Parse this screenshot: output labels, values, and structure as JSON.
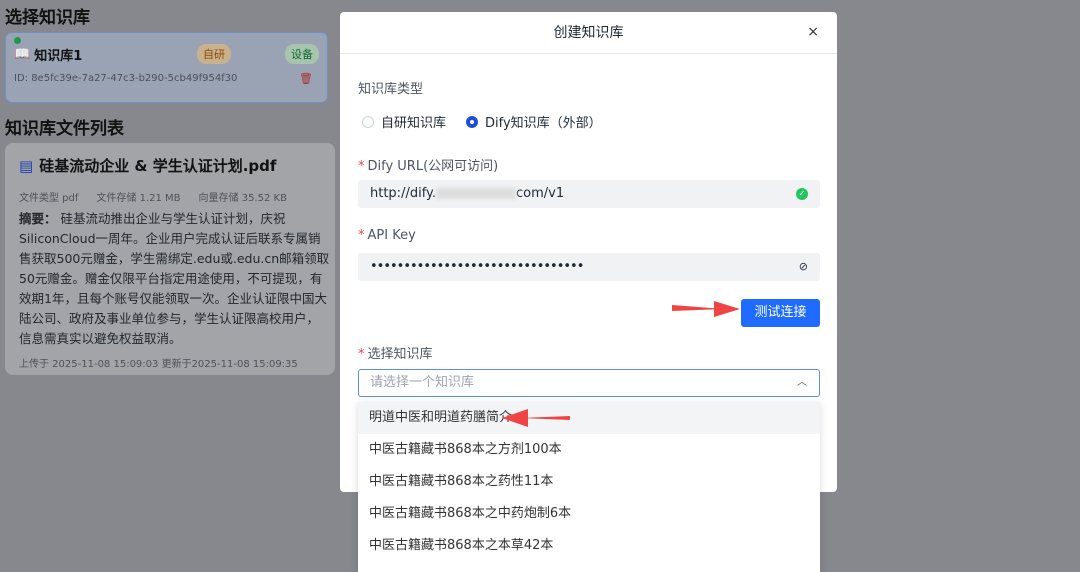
{
  "background": {
    "select_heading": "选择知识库",
    "kb_card": {
      "name": "知识库1",
      "tag_type": "自研",
      "tag_device": "设备",
      "id": "ID: 8e5fc39e-7a27-47c3-b290-5cb49f954f30"
    },
    "list_heading": "知识库文件列表",
    "file": {
      "title": "硅基流动企业 & 学生认证计划.pdf",
      "type": "文件类型 pdf",
      "storage": "文件存储 1.21 MB",
      "vector": "向量存储 35.52 KB",
      "summary_label": "摘要：",
      "summary": "硅基流动推出企业与学生认证计划，庆祝SiliconCloud一周年。企业用户完成认证后联系专属销售获取500元赠金，学生需绑定.edu或.edu.cn邮箱领取50元赠金。赠金仅限平台指定用途使用，不可提现，有效期1年，且每个账号仅能领取一次。企业认证限中国大陆公司、政府及事业单位参与，学生认证限高校用户，信息需真实以避免权益取消。",
      "dates": "上传于 2025-11-08 15:09:03 更新于2025-11-08 15:09:35"
    }
  },
  "modal": {
    "title": "创建知识库",
    "close": "×",
    "type_label": "知识库类型",
    "radio_options": [
      "自研知识库",
      "Dify知识库（外部）"
    ],
    "selected": "Dify知识库（外部）",
    "url_label": "Dify URL(公网可访问)",
    "url_prefix": "http://dify.",
    "url_suffix": "com/v1",
    "api_label": "API Key",
    "api_value": "••••••••••••••••••••••••••••••••",
    "test_button": "测试连接",
    "kb_label": "选择知识库",
    "kb_placeholder": "请选择一个知识库",
    "required_mark": "*"
  },
  "dropdown": {
    "options": [
      "明道中医和明道药膳简介",
      "中医古籍藏书868本之方剂100本",
      "中医古籍藏书868本之药性11本",
      "中医古籍藏书868本之中药炮制6本",
      "中医古籍藏书868本之本草42本"
    ]
  },
  "colors": {
    "primary": "#1f6bff",
    "annotation_arrow": "#ef4444",
    "success": "#22c55e"
  }
}
